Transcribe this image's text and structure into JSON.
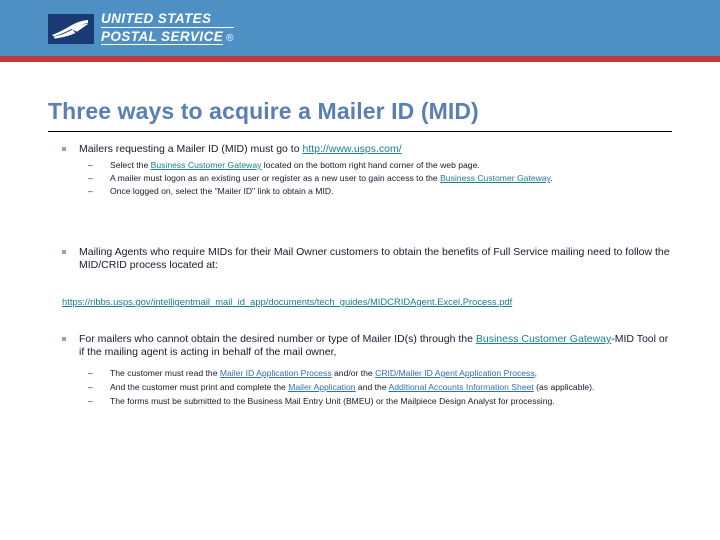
{
  "header": {
    "brand_line_1": "UNITED STATES",
    "brand_line_2": "POSTAL SERVICE",
    "registered_symbol": "®",
    "band_color": "#4e8fc4",
    "stripe_color": "#c03a3a",
    "eagle_box_color": "#1a3a73"
  },
  "title": {
    "text": "Three ways to acquire a Mailer ID (MID)",
    "color": "#5b7fb4"
  },
  "colors": {
    "link_teal": "#1a7f8e",
    "link_blue": "#2e6fb5",
    "body_text": "#1a1a2e",
    "bullet_square": "#8fa6c4"
  },
  "content": {
    "bullet1": {
      "text_before_link": "Mailers requesting a Mailer ID (MID) must go to ",
      "link": "http://www.usps.com/",
      "sub": [
        {
          "part1": "Select the ",
          "link1": "Business Customer Gateway",
          "part2": " located on the bottom right hand corner of the web page."
        },
        {
          "part1": "A mailer must logon as an existing user or register as a new user to gain access to the ",
          "link1": "Business Customer Gateway",
          "part2": "."
        },
        {
          "part1": "Once logged on, select the \"Mailer ID\" link to obtain a MID.",
          "link1": "",
          "part2": ""
        }
      ]
    },
    "bullet2": {
      "text": "Mailing Agents  who require MIDs for their Mail Owner customers to obtain the benefits of Full Service mailing need to follow the MID/CRID process located at:"
    },
    "url_line": {
      "link": "https://ribbs.usps.gov/intelligentmail_mail_id_app/documents/tech_guides/MIDCRIDAgent.Excel.Process.pdf"
    },
    "bullet3": {
      "part1": "For mailers who cannot obtain the desired number or type of Mailer ID(s) through the ",
      "link1": "Business Customer Gateway",
      "part2": "-MID Tool or if the mailing agent is acting in behalf of the mail owner,",
      "sub": [
        {
          "part1": "The customer must read the ",
          "link1": "Mailer ID Application Process",
          "part2": " and/or the ",
          "link2": "CRID/Mailer ID Agent Application Process",
          "part3": ","
        },
        {
          "part1": "And  the customer must print and complete the ",
          "link1": "Mailer Application",
          "part2": " and the ",
          "link2": "Additional Accounts Information Sheet",
          "part3": " (as applicable)."
        },
        {
          "part1": "The forms must be submitted to the Business Mail Entry Unit (BMEU) or the Mailpiece Design Analyst for processing.",
          "link1": "",
          "part2": "",
          "link2": "",
          "part3": ""
        }
      ]
    }
  }
}
